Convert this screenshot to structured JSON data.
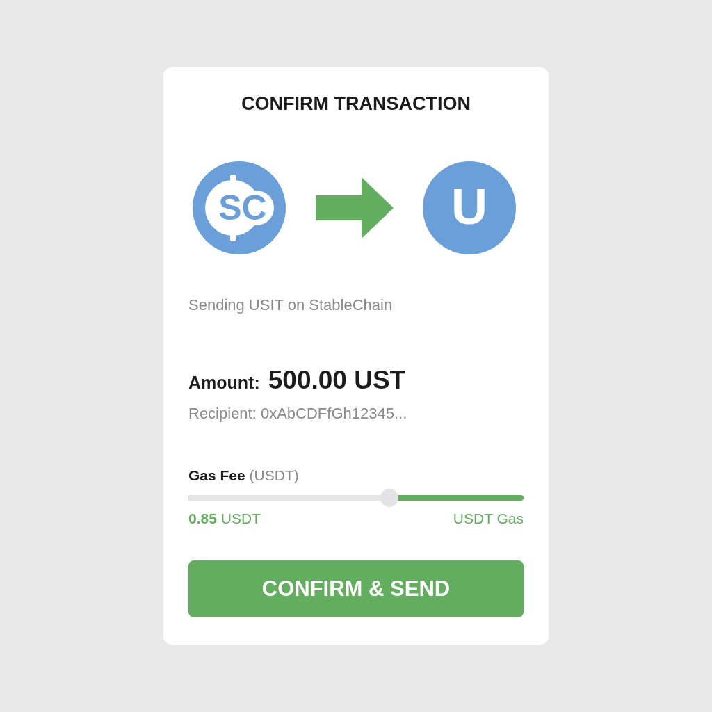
{
  "title": "CONFIRM TRANSACTION",
  "from_token": {
    "symbol": "SC"
  },
  "to_token": {
    "symbol": "U"
  },
  "network_note": "Sending USIT on StableChain",
  "amount": {
    "label": "Amount:",
    "value": "500.00 UST"
  },
  "recipient": "Recipient: 0xAbCDFfGh12345...",
  "gas_fee": {
    "label": "**Gas Fee** (USDT)",
    "level": 0.6,
    "value": "**0.85** USDT",
    "unit": "USDT Gas"
  },
  "confirm_button": "CONFIRM & SEND"
}
